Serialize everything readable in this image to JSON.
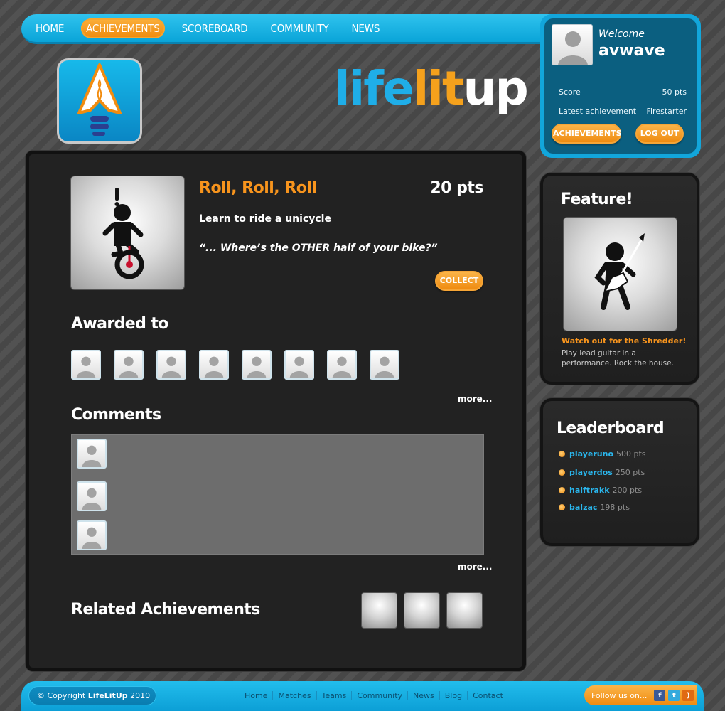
{
  "nav": {
    "items": [
      {
        "label": "HOME",
        "active": false
      },
      {
        "label": "ACHIEVEMENTS",
        "active": true
      },
      {
        "label": "SCOREBOARD",
        "active": false
      },
      {
        "label": "COMMUNITY",
        "active": false
      },
      {
        "label": "NEWS",
        "active": false
      }
    ]
  },
  "brand": {
    "part1": "life",
    "part2": "lit",
    "part3": "up"
  },
  "user": {
    "welcome": "Welcome",
    "username": "avwave",
    "score_label": "Score",
    "score_value": "50 pts",
    "latest_label": "Latest achievement",
    "latest_value": "Firestarter",
    "achievements_button": "ACHIEVEMENTS",
    "logout_button": "LOG OUT"
  },
  "achievement": {
    "title": "Roll, Roll, Roll",
    "points": "20 pts",
    "description": "Learn to ride a unicycle",
    "quote": "“... Where’s the OTHER half of your bike?”",
    "collect_button": "COLLECT"
  },
  "awarded": {
    "title": "Awarded to",
    "count": 8,
    "more": "more..."
  },
  "comments": {
    "title": "Comments",
    "count": 3,
    "more": "more..."
  },
  "related": {
    "title": "Related Achievements",
    "count": 3
  },
  "feature": {
    "title": "Feature!",
    "name": "Watch out for the Shredder!",
    "description": "Play lead guitar in a performance. Rock the house."
  },
  "leaderboard": {
    "title": "Leaderboard",
    "entries": [
      {
        "name": "playeruno",
        "points": "500 pts"
      },
      {
        "name": "playerdos",
        "points": "250 pts"
      },
      {
        "name": "halftrakk",
        "points": "200 pts"
      },
      {
        "name": "balzac",
        "points": "198 pts"
      }
    ]
  },
  "footer": {
    "copyright_prefix": "© Copyright",
    "copyright_brand": "LifeLitUp",
    "copyright_year": "2010",
    "links": [
      "Home",
      "Matches",
      "Teams",
      "Community",
      "News",
      "Blog",
      "Contact"
    ],
    "follow": "Follow us on...",
    "social": [
      "facebook-icon",
      "twitter-icon",
      "rss-icon"
    ]
  },
  "colors": {
    "accent_blue": "#12a6db",
    "accent_orange": "#f7941d",
    "panel_dark": "#222222"
  }
}
